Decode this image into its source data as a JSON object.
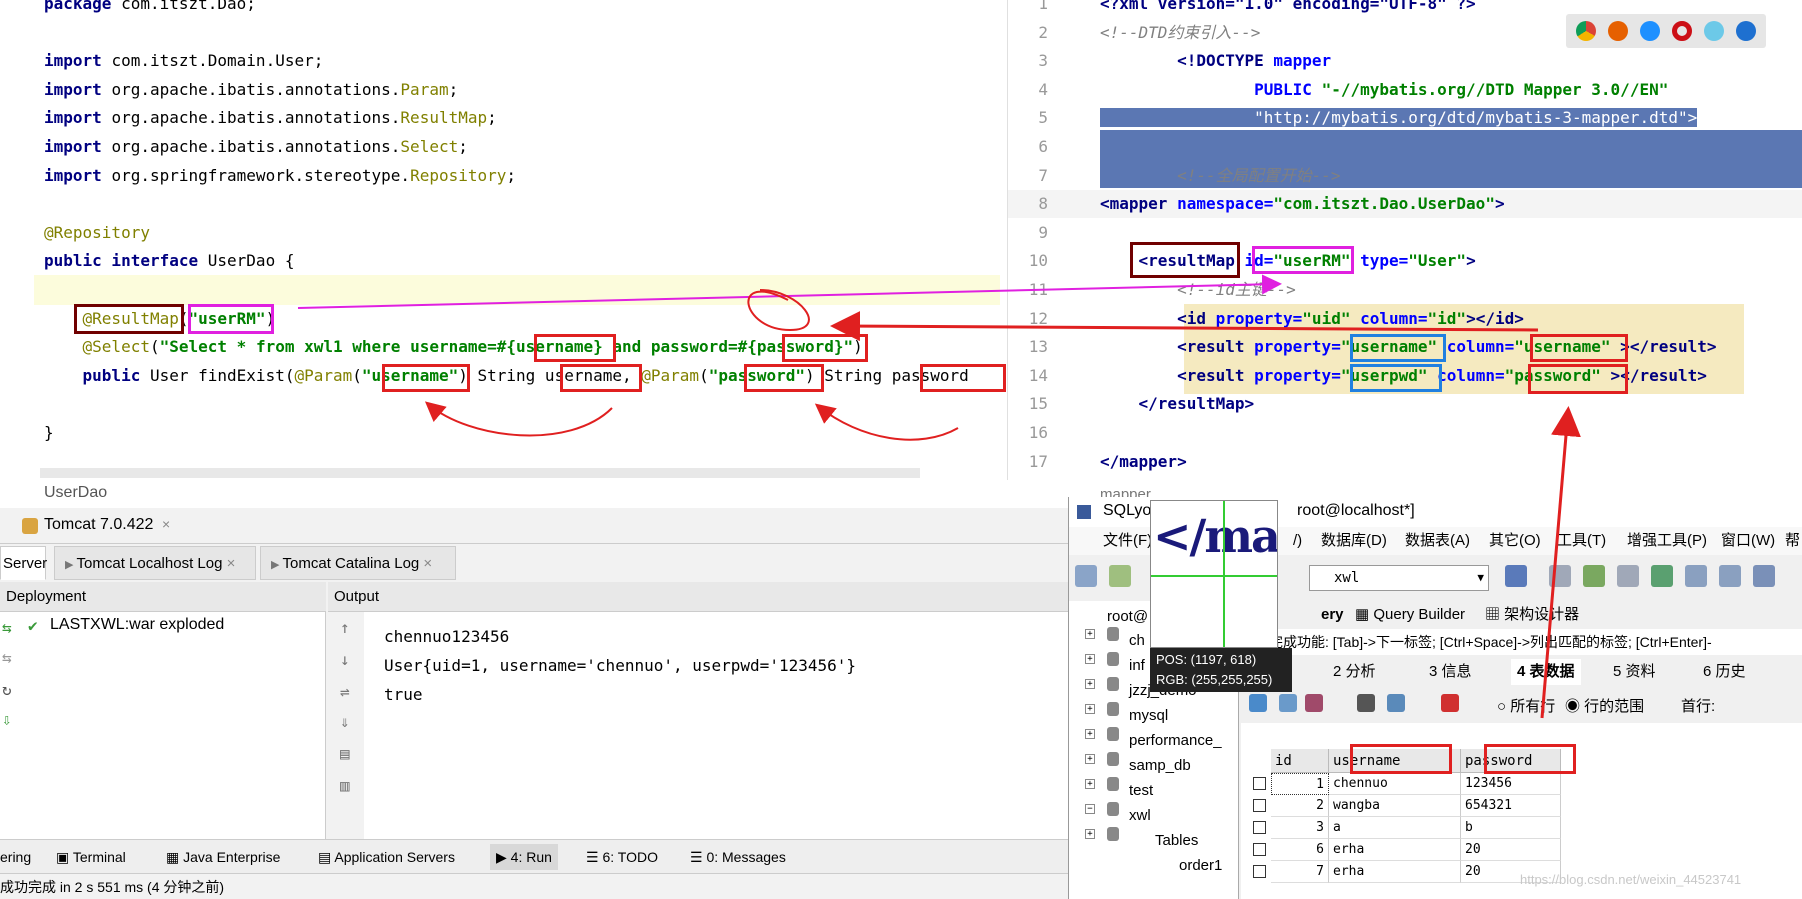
{
  "java": {
    "lines": [
      {
        "parts": [
          {
            "t": "package ",
            "c": "kw"
          },
          {
            "t": "com.itszt.Dao;",
            "c": "plain"
          }
        ]
      },
      {
        "parts": []
      },
      {
        "parts": [
          {
            "t": "import ",
            "c": "kw"
          },
          {
            "t": "com.itszt.Domain.User;",
            "c": "plain"
          }
        ]
      },
      {
        "parts": [
          {
            "t": "import ",
            "c": "kw"
          },
          {
            "t": "org.apache.ibatis.annotations.",
            "c": "plain"
          },
          {
            "t": "Param",
            "c": "ann"
          },
          {
            "t": ";",
            "c": "plain"
          }
        ]
      },
      {
        "parts": [
          {
            "t": "import ",
            "c": "kw"
          },
          {
            "t": "org.apache.ibatis.annotations.",
            "c": "plain"
          },
          {
            "t": "ResultMap",
            "c": "ann"
          },
          {
            "t": ";",
            "c": "plain"
          }
        ]
      },
      {
        "parts": [
          {
            "t": "import ",
            "c": "kw"
          },
          {
            "t": "org.apache.ibatis.annotations.",
            "c": "plain"
          },
          {
            "t": "Select",
            "c": "ann"
          },
          {
            "t": ";",
            "c": "plain"
          }
        ]
      },
      {
        "parts": [
          {
            "t": "import ",
            "c": "kw"
          },
          {
            "t": "org.springframework.stereotype.",
            "c": "plain"
          },
          {
            "t": "Repository",
            "c": "ann"
          },
          {
            "t": ";",
            "c": "plain"
          }
        ]
      },
      {
        "parts": []
      },
      {
        "parts": [
          {
            "t": "@Repository",
            "c": "ann"
          }
        ]
      },
      {
        "parts": [
          {
            "t": "public interface ",
            "c": "kw"
          },
          {
            "t": "UserDao {",
            "c": "plain"
          }
        ]
      },
      {
        "parts": []
      },
      {
        "parts": [
          {
            "t": "    @ResultMap",
            "c": "ann"
          },
          {
            "t": "(",
            "c": "plain"
          },
          {
            "t": "\"userRM\"",
            "c": "str"
          },
          {
            "t": ")",
            "c": "plain"
          }
        ]
      },
      {
        "parts": [
          {
            "t": "    @Select",
            "c": "ann"
          },
          {
            "t": "(",
            "c": "plain"
          },
          {
            "t": "\"Select * from xwl1 where username=#{username} and password=#{password}\"",
            "c": "str"
          },
          {
            "t": ")",
            "c": "plain"
          }
        ]
      },
      {
        "parts": [
          {
            "t": "    public ",
            "c": "kw"
          },
          {
            "t": "User findExist(",
            "c": "plain"
          },
          {
            "t": "@Param",
            "c": "ann"
          },
          {
            "t": "(",
            "c": "plain"
          },
          {
            "t": "\"username\"",
            "c": "str"
          },
          {
            "t": ") String username, ",
            "c": "plain"
          },
          {
            "t": "@Param",
            "c": "ann"
          },
          {
            "t": "(",
            "c": "plain"
          },
          {
            "t": "\"password\"",
            "c": "str"
          },
          {
            "t": ") String password",
            "c": "plain"
          }
        ]
      },
      {
        "parts": []
      },
      {
        "parts": [
          {
            "t": "}",
            "c": "plain"
          }
        ]
      }
    ],
    "tab_label": "UserDao"
  },
  "xml": {
    "line_numbers": [
      "1",
      "2",
      "3",
      "4",
      "5",
      "6",
      "7",
      "8",
      "9",
      "10",
      "11",
      "12",
      "13",
      "14",
      "15",
      "16",
      "17"
    ],
    "lines": [
      {
        "parts": [
          {
            "t": "<?xml version=\"1.0\" encoding=\"UTF-8\" ?>",
            "c": "tag"
          }
        ]
      },
      {
        "parts": [
          {
            "t": "<!--DTD约束引入-->",
            "c": "cmt"
          }
        ]
      },
      {
        "parts": [
          {
            "t": "        <!DOCTYPE ",
            "c": "tag"
          },
          {
            "t": "mapper",
            "c": "attr"
          }
        ]
      },
      {
        "parts": [
          {
            "t": "                PUBLIC ",
            "c": "attr"
          },
          {
            "t": "\"-//mybatis.org//DTD Mapper 3.0//EN\"",
            "c": "xval"
          }
        ]
      },
      {
        "parts": [
          {
            "t": "                \"http://mybatis.org/dtd/mybatis-3-mapper.dtd\">",
            "c": "sel"
          }
        ]
      },
      {
        "parts": []
      },
      {
        "parts": [
          {
            "t": "        <!--全局配置开始-->",
            "c": "cmt"
          }
        ]
      },
      {
        "parts": [
          {
            "t": "<mapper ",
            "c": "tag"
          },
          {
            "t": "namespace=",
            "c": "attr"
          },
          {
            "t": "\"com.itszt.Dao.UserDao\"",
            "c": "xval"
          },
          {
            "t": ">",
            "c": "tag"
          }
        ]
      },
      {
        "parts": []
      },
      {
        "parts": [
          {
            "t": "    <resultMap ",
            "c": "tag"
          },
          {
            "t": "id=",
            "c": "attr"
          },
          {
            "t": "\"userRM\"",
            "c": "xval"
          },
          {
            "t": " type=",
            "c": "attr"
          },
          {
            "t": "\"User\"",
            "c": "xval"
          },
          {
            "t": ">",
            "c": "tag"
          }
        ]
      },
      {
        "parts": [
          {
            "t": "        <!--id主键-->",
            "c": "cmt"
          }
        ]
      },
      {
        "parts": [
          {
            "t": "        <id ",
            "c": "tag"
          },
          {
            "t": "property=",
            "c": "attr"
          },
          {
            "t": "\"uid\"",
            "c": "xval"
          },
          {
            "t": " column=",
            "c": "attr"
          },
          {
            "t": "\"id\"",
            "c": "xval"
          },
          {
            "t": "></id>",
            "c": "tag"
          }
        ]
      },
      {
        "parts": [
          {
            "t": "        <result ",
            "c": "tag"
          },
          {
            "t": "property=",
            "c": "attr"
          },
          {
            "t": "\"username\"",
            "c": "xval"
          },
          {
            "t": " column=",
            "c": "attr"
          },
          {
            "t": "\"username\"",
            "c": "xval"
          },
          {
            "t": " ></result>",
            "c": "tag"
          }
        ]
      },
      {
        "parts": [
          {
            "t": "        <result ",
            "c": "tag"
          },
          {
            "t": "property=",
            "c": "attr"
          },
          {
            "t": "\"userpwd\"",
            "c": "xval"
          },
          {
            "t": " column=",
            "c": "attr"
          },
          {
            "t": "\"password\"",
            "c": "xval"
          },
          {
            "t": " ></result>",
            "c": "tag"
          }
        ]
      },
      {
        "parts": [
          {
            "t": "    </resultMap>",
            "c": "tag"
          }
        ]
      },
      {
        "parts": []
      },
      {
        "parts": [
          {
            "t": "</mapper>",
            "c": "tag"
          }
        ]
      }
    ],
    "footer_label": "mapper"
  },
  "run_panel": {
    "run_config": "Tomcat 7.0.422",
    "tabs": [
      "Server",
      "Tomcat Localhost Log",
      "Tomcat Catalina Log"
    ],
    "deployment_header": "Deployment",
    "output_header": "Output",
    "deployment_item": "LASTXWL:war exploded",
    "output_lines": [
      "chennuo123456",
      "User{uid=1, username='chennuo', userpwd='123456'}",
      "true"
    ]
  },
  "tool_windows": [
    {
      "label": "ering"
    },
    {
      "label": "Terminal"
    },
    {
      "label": "Java Enterprise"
    },
    {
      "label": "Application Servers"
    },
    {
      "label": "4: Run"
    },
    {
      "label": "6: TODO"
    },
    {
      "label": "0: Messages"
    }
  ],
  "status_bar": "成功完成 in 2 s 551 ms (4 分钟之前)",
  "sqlyog": {
    "title": "SQLyo",
    "title_suffix": "root@localhost*]",
    "menus": [
      "文件(F)",
      "/)",
      "数据库(D)",
      "数据表(A)",
      "其它(O)",
      "工具(T)",
      "增强工具(P)",
      "窗口(W)",
      "帮"
    ],
    "db_selector": "xwl",
    "root_label": "root@",
    "tree": [
      "ch",
      "inf",
      "jzzj_demo",
      "mysql",
      "performance_",
      "samp_db",
      "test",
      "xwl",
      "Tables",
      "order1"
    ],
    "query_tabs": [
      "ery",
      "Query Builder",
      "架构设计器"
    ],
    "hint": "自动完成功能: [Tab]->下一标签; [Ctrl+Space]->列出匹配的标签; [Ctrl+Enter]-",
    "result_tabs": [
      "结果",
      "2 分析",
      "3 信息",
      "4 表数据",
      "5 资料",
      "6 历史"
    ],
    "radio_all": "所有行",
    "radio_range": "行的范围",
    "first_row": "首行:",
    "columns": [
      "id",
      "username",
      "password"
    ],
    "rows": [
      [
        "1",
        "chennuo",
        "123456"
      ],
      [
        "2",
        "wangba",
        "654321"
      ],
      [
        "3",
        "a",
        "b"
      ],
      [
        "6",
        "erha",
        "20"
      ],
      [
        "7",
        "erha",
        "20"
      ]
    ]
  },
  "magnifier": {
    "text": "</map",
    "pos": "POS: (1197, 618)",
    "rgb": "RGB: (255,255,255)"
  },
  "watermark": "https://blog.csdn.net/weixin_44523741",
  "colors": {
    "selection": "#5b77b3",
    "annotation_red": "#e02020",
    "annotation_magenta": "#e020e0",
    "annotation_blue": "#2080e0"
  }
}
